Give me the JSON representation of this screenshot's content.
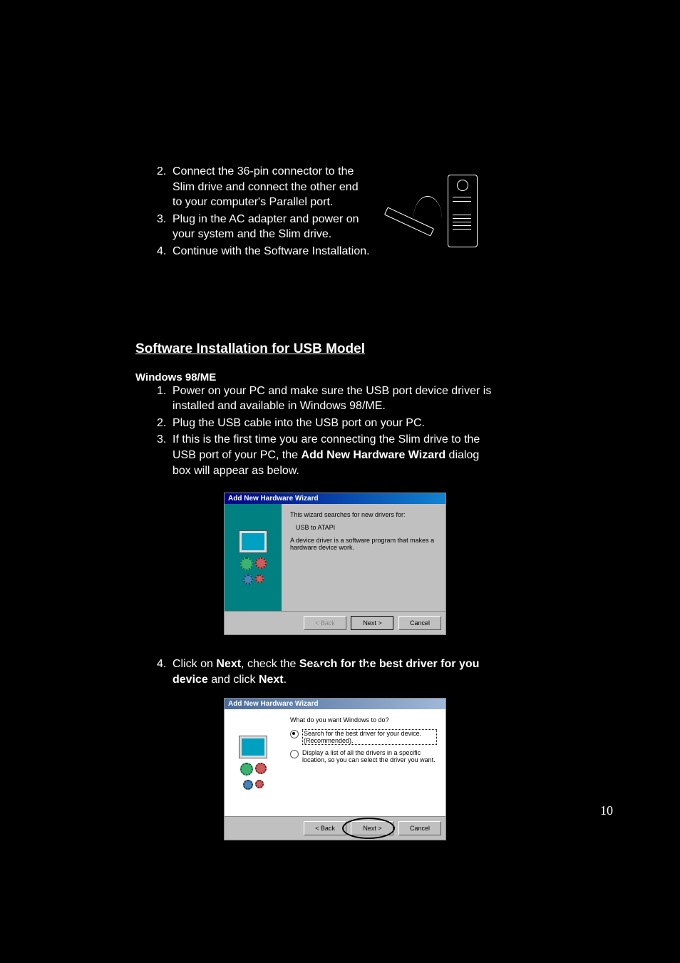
{
  "hardware_steps": [
    {
      "n": "2.",
      "text": "Connect the 36-pin connector to the Slim drive and connect the other end  to your computer's Parallel port."
    },
    {
      "n": "3.",
      "text": "Plug in the AC adapter and power on your system and the Slim drive."
    },
    {
      "n": "4.",
      "text": "Continue with the Software Installation."
    }
  ],
  "section_title": "Software Installation for USB Model",
  "os_heading": "Windows 98/ME",
  "usb_steps": [
    {
      "n": "1.",
      "text": "Power on your PC and make sure the USB port device driver is installed and available in Windows 98/ME."
    },
    {
      "n": "2.",
      "text": "Plug the USB cable into the USB port on your PC."
    }
  ],
  "usb_step3": {
    "n": "3.",
    "pre": "If this is the first time you are connecting the Slim drive to the USB port of your PC, the ",
    "bold": "Add New Hardware Wizard",
    "post": " dialog box will appear as below."
  },
  "dialog1": {
    "title": "Add New Hardware Wizard",
    "line1": "This wizard searches for new drivers for:",
    "device": "USB to ATAPI",
    "line2": "A device driver is a software program that makes a hardware device work.",
    "back": "< Back",
    "next": "Next >",
    "cancel": "Cancel"
  },
  "step4": {
    "n": "4.",
    "parts": [
      "Click on ",
      "Next",
      ", check the ",
      "Search for the best driver for you device",
      " and click ",
      "Next",
      "."
    ]
  },
  "dialog2": {
    "title": "Add New Hardware Wizard",
    "prompt": "What do you want Windows to do?",
    "opt1": "Search for the best driver for your device. (Recommended).",
    "opt2": "Display a list of all the drivers in a specific location, so you can select the driver you want.",
    "back": "< Back",
    "next": "Next >",
    "cancel": "Cancel"
  },
  "page_number": "10"
}
